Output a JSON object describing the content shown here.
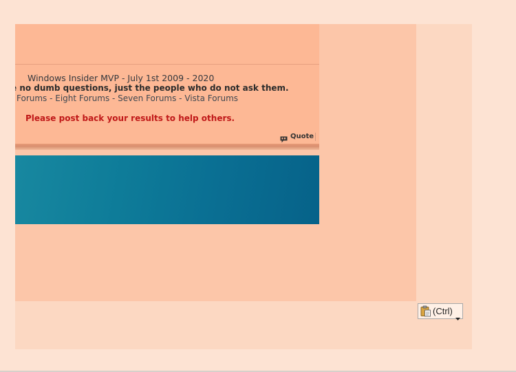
{
  "signature": {
    "title_line": "Windows Insider MVP - July 1st 2009 - 2020",
    "quote_line": "e no dumb questions, just the people who do not ask them.",
    "forums_line": "Forums - Eight Forums - Seven Forums - Vista Forums",
    "help_line": "Please post back your results to help others."
  },
  "post_actions": {
    "quote_label": "Quote",
    "quote_icon": "quote-speech-bubble-icon"
  },
  "paste_options": {
    "label": "(Ctrl)",
    "icon": "clipboard-icon",
    "dropdown_icon": "chevron-down-icon"
  },
  "colors": {
    "page_background": "#fde3d3",
    "post_background": "#fdb895",
    "help_text": "#c01818",
    "banner_teal": "#0e7c99"
  }
}
